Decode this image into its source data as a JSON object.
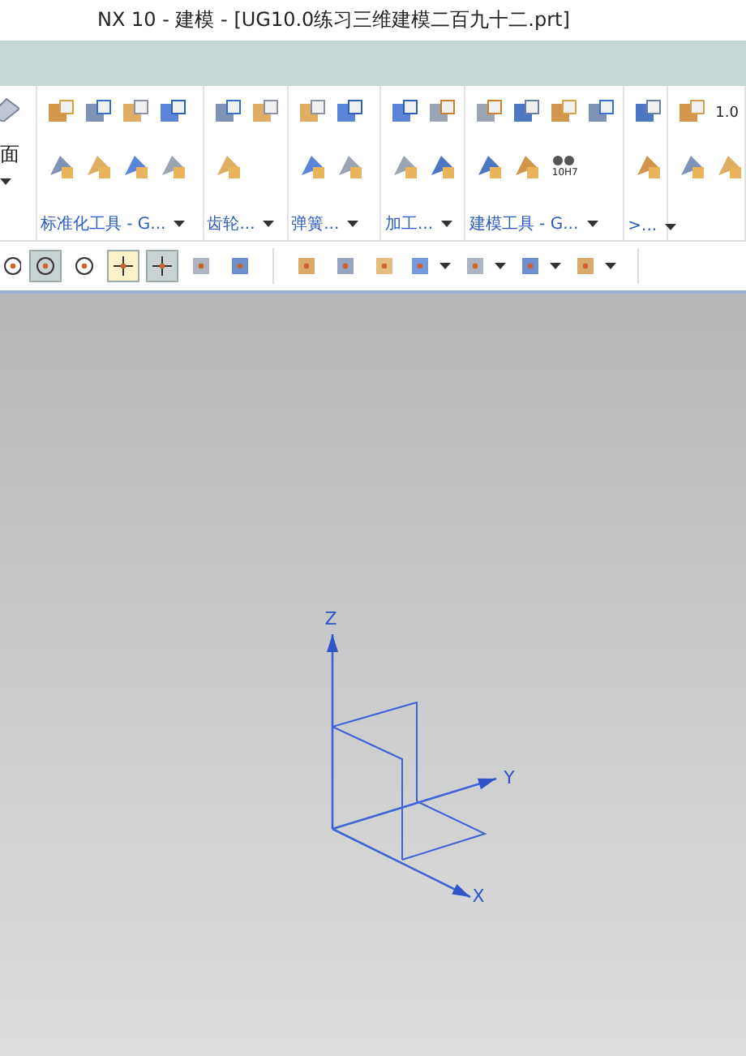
{
  "window": {
    "title": "NX 10 - 建模 - [UG10.0练习三维建模二百九十二.prt]"
  },
  "ribbon": {
    "left_edge_label": "面",
    "groups": [
      {
        "label": "标准化工具 - G..."
      },
      {
        "label": "齿轮..."
      },
      {
        "label": "弹簧..."
      },
      {
        "label": "加工..."
      },
      {
        "label": "建模工具 - G..."
      },
      {
        "label": ">..."
      }
    ],
    "fit_icon_text": "10H7",
    "edge_value": "1.0"
  },
  "toolbar": {
    "buttons": [
      {
        "selected": false,
        "has_dropdown": false
      },
      {
        "selected": true,
        "has_dropdown": false
      },
      {
        "selected": false,
        "has_dropdown": false
      },
      {
        "selected": true,
        "has_dropdown": false
      },
      {
        "selected": true,
        "has_dropdown": false
      },
      {
        "selected": false,
        "has_dropdown": false
      },
      {
        "selected": false,
        "has_dropdown": false
      },
      {
        "selected": false,
        "has_dropdown": false
      },
      {
        "selected": false,
        "has_dropdown": false
      },
      {
        "selected": false,
        "has_dropdown": false
      },
      {
        "selected": false,
        "has_dropdown": true
      },
      {
        "selected": false,
        "has_dropdown": true
      },
      {
        "selected": false,
        "has_dropdown": true
      },
      {
        "selected": false,
        "has_dropdown": true
      }
    ]
  },
  "viewport": {
    "axes": [
      {
        "label": "Z"
      },
      {
        "label": "Y"
      },
      {
        "label": "X"
      }
    ]
  }
}
